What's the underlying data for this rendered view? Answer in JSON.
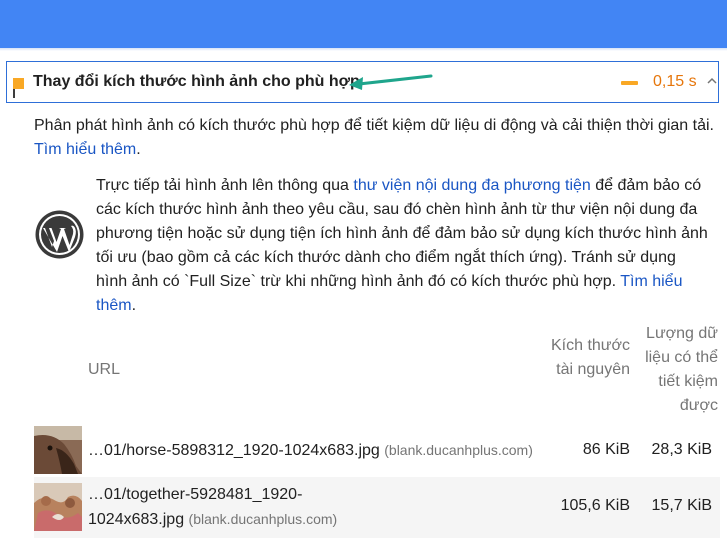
{
  "colors": {
    "header_bar": "#4285f4",
    "warning": "#f9a825",
    "savings_text": "#e6760b",
    "link": "#1a56c4",
    "arrow": "#1fa58c"
  },
  "audit": {
    "title": "Thay đổi kích thước hình ảnh cho phù hợp",
    "savings": "0,15 s",
    "warning_icon": "warning-square-icon",
    "chevron_icon": "chevron-up-icon"
  },
  "description": {
    "text": "Phân phát hình ảnh có kích thước phù hợp để tiết kiệm dữ liệu di động và cải thiện thời gian tải.",
    "learn_more": "Tìm hiểu thêm"
  },
  "wordpress_tip": {
    "icon": "wordpress-logo-icon",
    "part1": "Trực tiếp tải hình ảnh lên thông qua ",
    "link1": "thư viện nội dung đa phương tiện",
    "part2": " để đảm bảo có các kích thước hình ảnh theo yêu cầu, sau đó chèn hình ảnh từ thư viện nội dung đa phương tiện hoặc sử dụng tiện ích hình ảnh để đảm bảo sử dụng kích thước hình ảnh tối ưu (bao gồm cả các kích thước dành cho điểm ngắt thích ứng). Tránh sử dụng hình ảnh có `Full Size` trừ khi những hình ảnh đó có kích thước phù hợp. ",
    "link2": "Tìm hiểu thêm"
  },
  "table": {
    "headers": {
      "url": "URL",
      "size": "Kích thước tài nguyên",
      "waste": "Lượng dữ liệu có thể tiết kiệm được"
    },
    "rows": [
      {
        "url": "…01/horse-5898312_1920-1024x683.jpg",
        "host": "(blank.ducanhplus.com)",
        "size": "86 KiB",
        "waste": "28,3 KiB",
        "thumb": "horse-thumbnail"
      },
      {
        "url": "…01/together-5928481_1920-1024x683.jpg",
        "host": "(blank.ducanhplus.com)",
        "size": "105,6 KiB",
        "waste": "15,7 KiB",
        "thumb": "together-thumbnail"
      }
    ]
  }
}
